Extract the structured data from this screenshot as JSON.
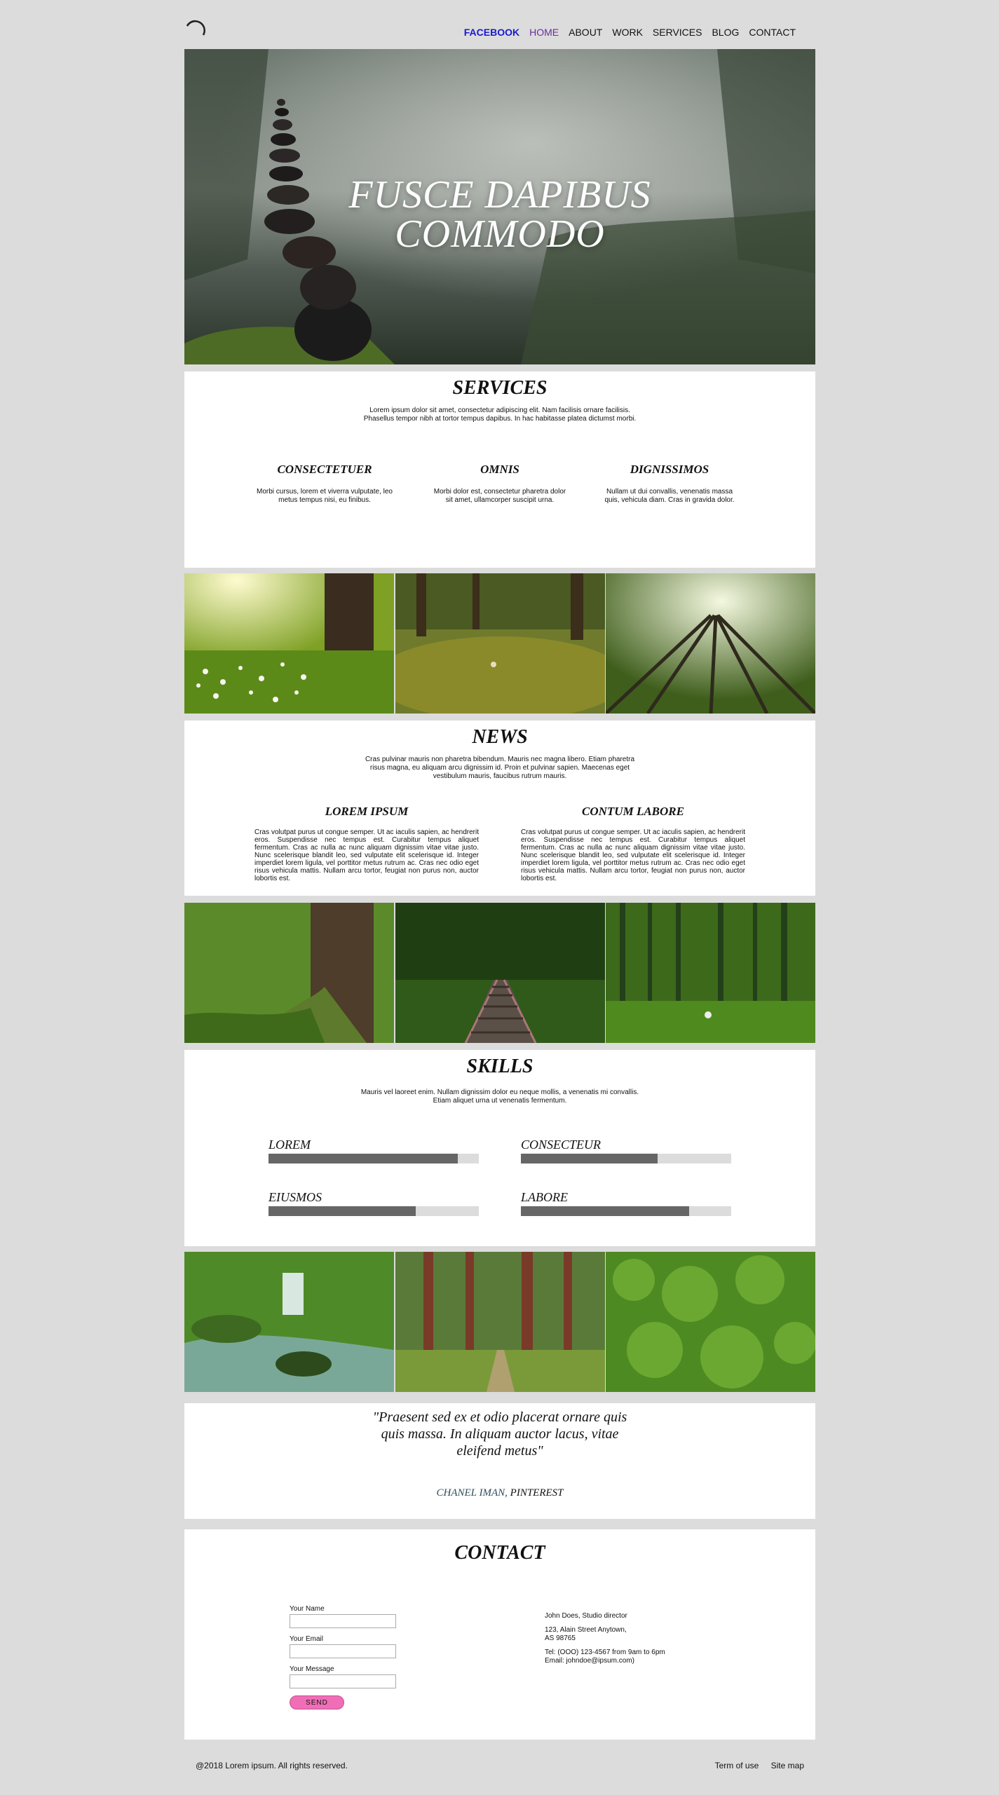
{
  "header": {
    "nav": [
      "FACEBOOK",
      "HOME",
      "ABOUT",
      "WORK",
      "SERVICES",
      "BLOG",
      "CONTACT"
    ]
  },
  "hero": {
    "title": "FUSCE DAPIBUS COMMODO"
  },
  "services": {
    "title": "SERVICES",
    "description": "Lorem ipsum dolor sit amet, consectetur adipiscing elit. Nam facilisis ornare facilisis. Phasellus tempor nibh at tortor tempus dapibus. In hac habitasse platea dictumst morbi.",
    "items": [
      {
        "title": "CONSECTETUER",
        "text": "Morbi cursus, lorem et viverra vulputate, leo metus tempus nisi, eu finibus."
      },
      {
        "title": "OMNIS",
        "text": "Morbi dolor est, consectetur pharetra dolor sit amet, ullamcorper suscipit urna."
      },
      {
        "title": "DIGNISSIMOS",
        "text": "Nullam ut dui convallis, venenatis massa quis, vehicula diam. Cras in gravida dolor."
      }
    ]
  },
  "news": {
    "title": "NEWS",
    "description": "Cras pulvinar mauris non pharetra bibendum. Mauris nec magna libero. Etiam pharetra risus magna, eu aliquam arcu dignissim id. Proin et pulvinar sapien. Maecenas eget vestibulum mauris, faucibus rutrum mauris.",
    "items": [
      {
        "title": "LOREM IPSUM",
        "text": "Cras volutpat purus ut congue semper. Ut ac iaculis sapien, ac hendrerit eros. Suspendisse nec tempus est. Curabitur tempus aliquet fermentum. Cras ac nulla ac nunc aliquam dignissim vitae vitae justo. Nunc scelerisque blandit leo, sed vulputate elit scelerisque id. Integer imperdiet lorem ligula, vel porttitor metus rutrum ac. Cras nec odio eget risus vehicula mattis. Nullam arcu tortor, feugiat non purus non, auctor lobortis est."
      },
      {
        "title": "CONTUM LABORE",
        "text": "Cras volutpat purus ut congue semper. Ut ac iaculis sapien, ac hendrerit eros. Suspendisse nec tempus est. Curabitur tempus aliquet fermentum. Cras ac nulla ac nunc aliquam dignissim vitae vitae justo. Nunc scelerisque blandit leo, sed vulputate elit scelerisque id. Integer imperdiet lorem ligula, vel porttitor metus rutrum ac. Cras nec odio eget risus vehicula mattis. Nullam arcu tortor, feugiat non purus non, auctor lobortis est."
      }
    ]
  },
  "skills": {
    "title": "SKILLS",
    "description": "Mauris vel laoreet enim. Nullam dignissim dolor eu neque mollis, a venenatis mi convallis. Etiam aliquet urna ut venenatis fermentum.",
    "items": [
      {
        "label": "LOREM",
        "level": 0.9
      },
      {
        "label": "CONSECTEUR",
        "level": 0.65
      },
      {
        "label": "EIUSMOS",
        "level": 0.7
      },
      {
        "label": "LABORE",
        "level": 0.8
      }
    ]
  },
  "quote": {
    "text": "\"Praesent sed ex et odio placerat ornare quis quis massa. In aliquam auctor lacus, vitae eleifend metus\"",
    "author_name": "CHANEL IMAN,",
    "author_source": "PINTEREST"
  },
  "contact": {
    "title": "CONTACT",
    "name_label": "Your Name",
    "email_label": "Your Email",
    "message_label": "Your Message",
    "send_label": "SEND",
    "person": "John Does, Studio director",
    "address1": "123, Alain Street Anytown,",
    "address2": "AS 98765",
    "tel": "Tel: (OOO) 123-4567 from 9am to 6pm",
    "email": "Email: johndoe@ipsum.com)"
  },
  "footer": {
    "copyright": "@2018 Lorem ipsum. All rights reserved.",
    "links": [
      "Term of use",
      "Site map"
    ]
  },
  "colors": {
    "page_bg": "#dcdcdc",
    "nav_facebook": "#1a1acd",
    "nav_home": "#6a2d9e",
    "send_button": "#f06eb6",
    "skill_fill": "#666666",
    "skill_track": "#dcdcdc"
  }
}
